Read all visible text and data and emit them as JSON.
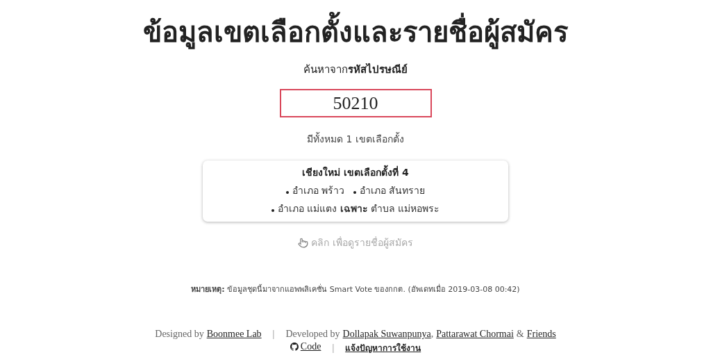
{
  "title": "ข้อมูลเขตเลือกตั้งและรายชื่อผู้สมัคร",
  "subtitle": "ค้นหาจาก**รหัสไปรษณีย์**",
  "search": {
    "value": "50210"
  },
  "count": "มีทั้งหมด 1 เขตเลือกตั้ง",
  "district_card": {
    "title": "เชียงใหม่ เขตเลือกตั้งที่ 4",
    "lines": [
      [
        "อำเภอ พร้าว",
        "อำเภอ สันทราย"
      ],
      [
        "อำเภอ แม่แตง **เฉพาะ** ตำบล แม่หอพระ"
      ]
    ]
  },
  "hint": "คลิก เพื่อดูรายชื่อผู้สมัคร",
  "note": "**หมายเหตุ:** ข้อมูลชุดนี้มาจากแอพพลิเคชั่น Smart Vote ของกกต. (อัพเดทเมื่อ 2019-03-08 00:42)",
  "footer": {
    "designed_label": "Designed by",
    "designer": "Boonmee Lab",
    "separator": "|",
    "developed_label": "Developed by",
    "developers": [
      "Dollapak Suwanpunya",
      "Pattarawat Chormai"
    ],
    "comma": ",",
    "ampersand": "&",
    "friends": "Friends",
    "code_link": "Code",
    "separator_2": "|",
    "report_link": "แจ้งปัญหาการใช้งาน"
  }
}
